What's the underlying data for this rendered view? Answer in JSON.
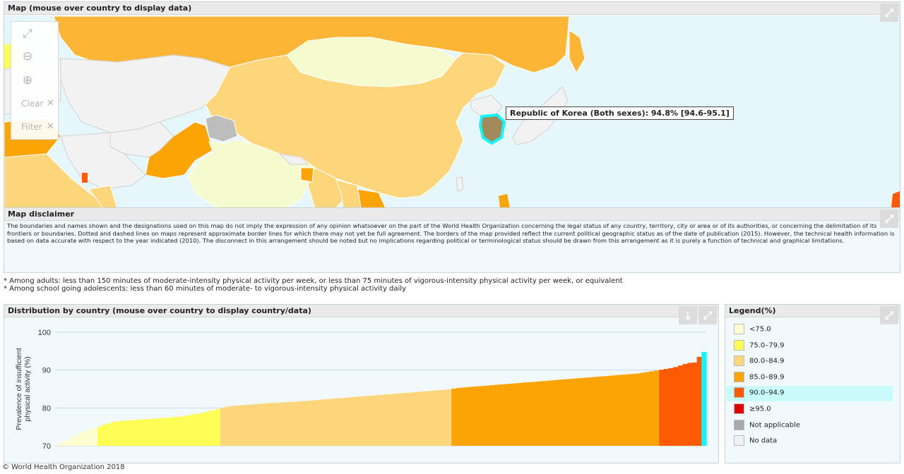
{
  "map": {
    "title": "Map (mouse over country to display data)",
    "tools": {
      "clear": "Clear",
      "filter": "Filter"
    },
    "tooltip": "Republic of Korea (Both sexes): 94.8% [94.6-95.1]"
  },
  "disclaimer": {
    "title": "Map disclaimer",
    "text": "The boundaries and names shown and the designations used on this map do not imply the expression of any opinion whatsoever on the part of the World Health Organization concerning the legal status of any country, territory, city or area or of its authorities, or concerning the delimitation of its frontiers or boundaries. Dotted and dashed lines on maps represent approximate border lines for which there may not yet be full agreement. The borders of the map provided reflect the current political geographic status as of the date of publication (2015). However, the technical health information is based on data accurate with respect to the year indicated (2010). The disconnect in this arrangement should be noted but no implications regarding political or terminological status should be drawn from this arrangement as it is purely a function of technical and graphical limitations."
  },
  "notes": [
    "* Among adults: less than 150 minutes of moderate-intensity physical activity per week, or less than 75 minutes of vigorous-intensity physical activity per week, or equivalent",
    "* Among school going adolescents: less than 60 minutes of moderate- to vigorous-intensity physical activity daily"
  ],
  "distribution": {
    "title": "Distribution by country (mouse over country to display country/data)"
  },
  "legend": {
    "title": "Legend(%)",
    "items": [
      {
        "label": "<75.0",
        "color": "#fdfdcf"
      },
      {
        "label": "75.0–79.9",
        "color": "#fefe57"
      },
      {
        "label": "80.0–84.9",
        "color": "#fdd57a"
      },
      {
        "label": "85.0–89.9",
        "color": "#fda405"
      },
      {
        "label": "90.0–94.9",
        "color": "#fd5a04"
      },
      {
        "label": "≥95.0",
        "color": "#e00000"
      },
      {
        "label": "Not applicable",
        "color": "#a9a9a9"
      },
      {
        "label": "No data",
        "color": "#f2f2f2"
      }
    ]
  },
  "chart_data": {
    "type": "bar",
    "xlabel": "",
    "ylabel": "Prevalence of insufficient physical activity (%)",
    "ylim": [
      70,
      100
    ],
    "yticks": [
      70,
      80,
      90,
      100
    ],
    "grid": true,
    "highlight": {
      "name": "Republic of Korea",
      "value": 94.8,
      "color": "#14f5f7"
    },
    "groups": [
      {
        "color": "#fdfdcf",
        "values": [
          70.3,
          70.8,
          71.5,
          72.2,
          72.9,
          73.5,
          74.0,
          74.3,
          74.7
        ]
      },
      {
        "color": "#fefe57",
        "values": [
          75.1,
          75.6,
          76.0,
          76.3,
          76.5,
          76.6,
          76.7,
          76.8,
          76.9,
          77.0,
          77.0,
          77.1,
          77.2,
          77.3,
          77.4,
          77.5,
          77.6,
          77.7,
          77.9,
          78.1,
          78.3,
          78.5,
          78.8,
          79.1,
          79.4,
          79.7
        ]
      },
      {
        "color": "#fdd57a",
        "values": [
          80.1,
          80.3,
          80.5,
          80.6,
          80.7,
          80.8,
          80.9,
          81.0,
          81.1,
          81.2,
          81.3,
          81.3,
          81.4,
          81.5,
          81.6,
          81.6,
          81.7,
          81.8,
          81.9,
          82.0,
          82.1,
          82.2,
          82.3,
          82.4,
          82.5,
          82.6,
          82.7,
          82.8,
          82.9,
          83.0,
          83.1,
          83.2,
          83.3,
          83.4,
          83.5,
          83.6,
          83.7,
          83.8,
          83.9,
          84.0,
          84.1,
          84.2,
          84.3,
          84.4,
          84.5,
          84.6,
          84.7,
          84.8,
          84.9
        ]
      },
      {
        "color": "#fda405",
        "values": [
          85.1,
          85.3,
          85.4,
          85.5,
          85.6,
          85.7,
          85.8,
          85.9,
          86.0,
          86.1,
          86.2,
          86.3,
          86.4,
          86.5,
          86.6,
          86.7,
          86.8,
          86.9,
          87.0,
          87.1,
          87.2,
          87.3,
          87.4,
          87.5,
          87.6,
          87.7,
          87.8,
          87.9,
          88.0,
          88.1,
          88.2,
          88.3,
          88.4,
          88.5,
          88.6,
          88.7,
          88.8,
          88.9,
          89.0,
          89.1,
          89.3,
          89.5,
          89.7,
          89.9
        ]
      },
      {
        "color": "#fd5a04",
        "values": [
          90.1,
          90.3,
          90.5,
          90.8,
          91.2,
          91.6,
          91.9,
          92.0,
          93.5
        ]
      }
    ]
  }
}
